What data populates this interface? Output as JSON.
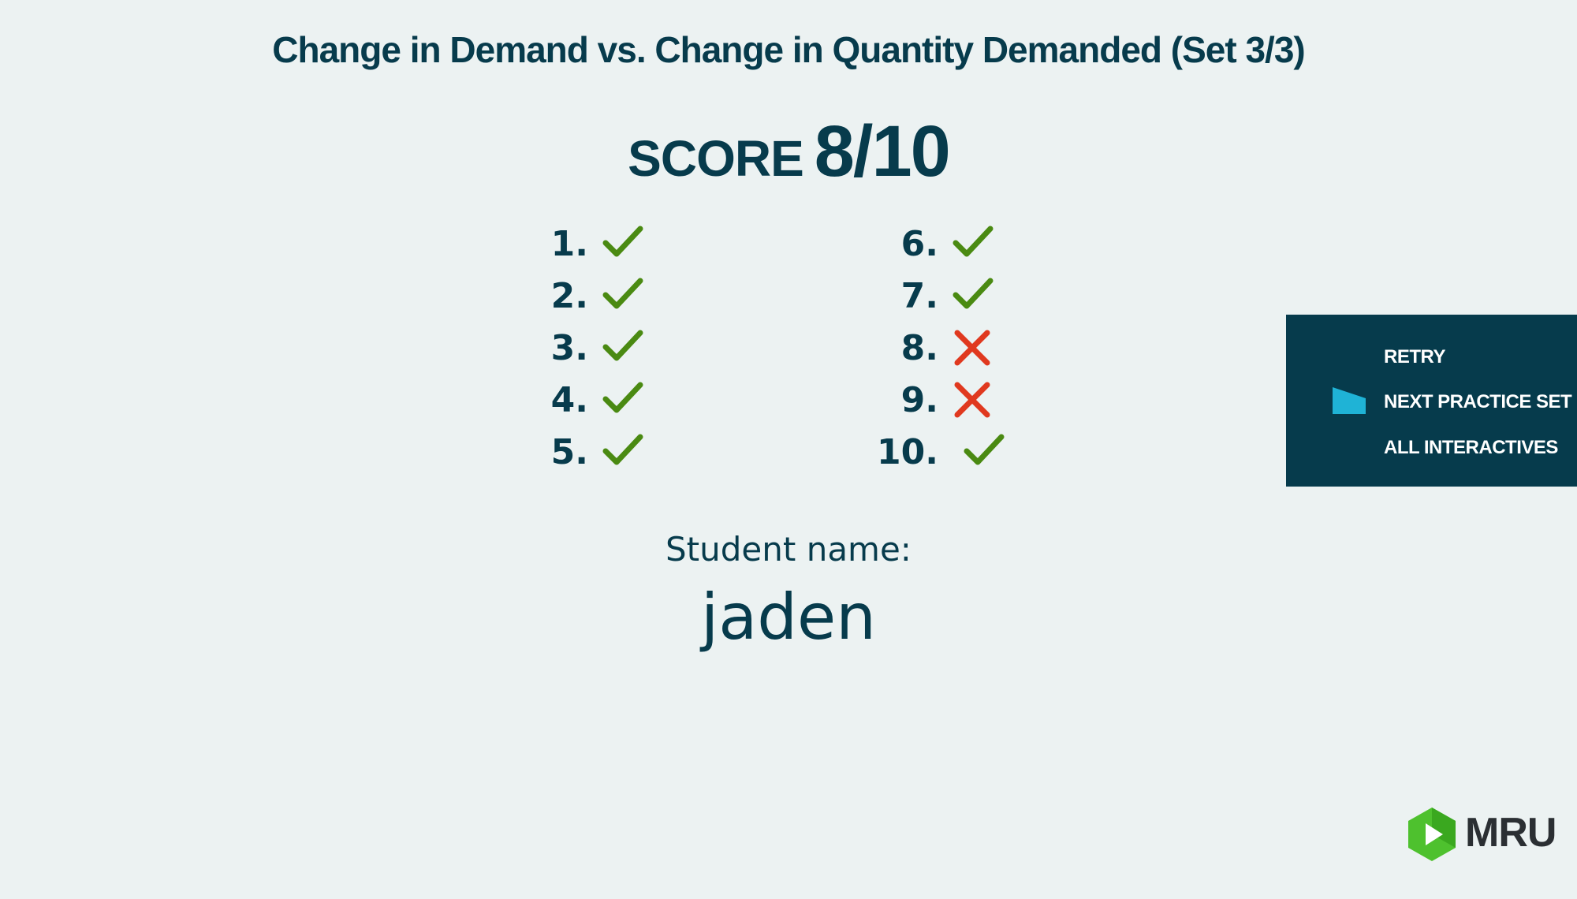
{
  "header": {
    "title": "Change in Demand vs. Change in Quantity Demanded (Set 3/3)"
  },
  "score": {
    "label": "SCORE",
    "value": "8/10"
  },
  "results": [
    {
      "number": "1.",
      "correct": true
    },
    {
      "number": "2.",
      "correct": true
    },
    {
      "number": "3.",
      "correct": true
    },
    {
      "number": "4.",
      "correct": true
    },
    {
      "number": "5.",
      "correct": true
    },
    {
      "number": "6.",
      "correct": true
    },
    {
      "number": "7.",
      "correct": true
    },
    {
      "number": "8.",
      "correct": false
    },
    {
      "number": "9.",
      "correct": false
    },
    {
      "number": "10.",
      "correct": true
    }
  ],
  "menu": {
    "retry": "RETRY",
    "next_practice_set": "NEXT PRACTICE SET",
    "all_interactives": "ALL INTERACTIVES",
    "marker_icon": "selected-marker-icon"
  },
  "student": {
    "label": "Student name:",
    "name": "jaden"
  },
  "logo": {
    "text": "MRU",
    "icon": "play-hexagon-icon"
  },
  "colors": {
    "background": "#ecf2f2",
    "text": "#073b4c",
    "correct": "#4a8a12",
    "incorrect": "#e0391f",
    "menu_background": "#063b4c",
    "menu_marker": "#1fb3d6",
    "logo_green": "#4ec12e"
  }
}
